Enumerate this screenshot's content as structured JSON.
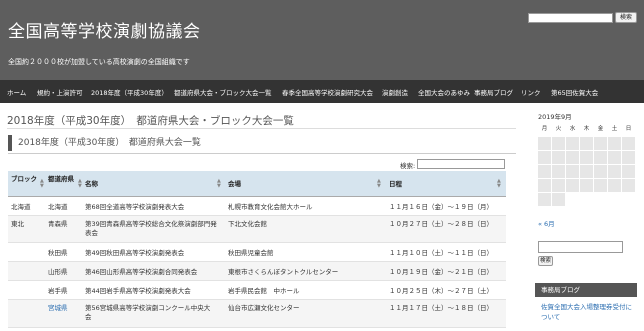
{
  "header": {
    "site_title": "全国高等学校演劇協議会",
    "site_description": "全国約２０００校が加盟している高校演劇の全国組織です",
    "search_button": "検索"
  },
  "nav": {
    "items": [
      "ホーム",
      "規約・上演許可",
      "2018年度（平成30年度）",
      "都道府県大会・ブロック大会一覧",
      "春季全国高等学校演劇研究大会",
      "演劇創造",
      "全国大会のあゆみ",
      "事務局ブログ",
      "リンク",
      "第65回佐賀大会"
    ]
  },
  "main": {
    "page_title": "2018年度（平成30年度）　都道府県大会・ブロック大会一覧",
    "section_title": "2018年度（平成30年度）　都道府県大会一覧",
    "filter_label": "検索:",
    "table": {
      "headers": [
        "ブロック",
        "都道府県",
        "名称",
        "会場",
        "日程"
      ],
      "rows": [
        [
          "北海道",
          "北海道",
          "第68回全道高等学校演劇発表大会",
          "札幌市教育文化会館大ホール",
          "１１月１６日（金）～１９日（月）"
        ],
        [
          "東北",
          "青森県",
          "第39回青森県高等学校総合文化祭演劇部門発表会",
          "下北文化会館",
          "１０月２７日（土）～２８日（日）"
        ],
        [
          "",
          "秋田県",
          "第49回秋田県高等学校演劇発表会",
          "秋田県児童会館",
          "１１月１０日（土）～１１日（日）"
        ],
        [
          "",
          "山形県",
          "第46回山形県高等学校演劇合同発表会",
          "東根市さくらんぼタントクルセンター",
          "１０月１９日（金）～２１日（日）"
        ],
        [
          "",
          "岩手県",
          "第44回岩手県高等学校演劇発表大会",
          "岩手県民会館　中ホール",
          "１０月２５日（木）～２７日（土）"
        ],
        [
          "",
          "宮城県",
          "第56宮城県高等学校演劇コンクール中央大会",
          "仙台市広瀬文化センター",
          "１１月１７日（土）～１８日（日）"
        ]
      ]
    }
  },
  "sidebar": {
    "calendar_title": "2019年9月",
    "weekdays": [
      "月",
      "火",
      "水",
      "木",
      "金",
      "土",
      "日"
    ],
    "prev_link": "« 6月",
    "search_button": "検索",
    "blog_heading": "事務局ブログ",
    "blog_link": "佐賀全国大会入場整理券受付について"
  }
}
